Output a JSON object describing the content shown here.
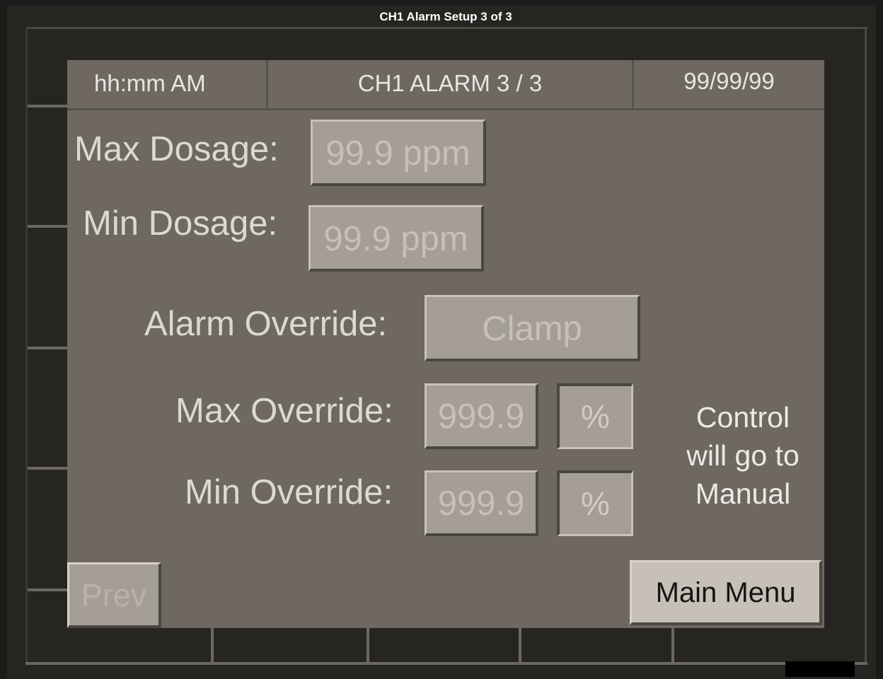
{
  "window": {
    "title": "CH1 Alarm Setup 3 of 3"
  },
  "status_bar": {
    "time": "hh:mm AM",
    "screen_title": "CH1 ALARM 3 / 3",
    "date": "99/99/99"
  },
  "form": {
    "max_dosage": {
      "label": "Max Dosage:",
      "value": "99.9 ppm"
    },
    "min_dosage": {
      "label": "Min Dosage:",
      "value": "99.9 ppm"
    },
    "alarm_override": {
      "label": "Alarm Override:",
      "value": "Clamp"
    },
    "max_override": {
      "label": "Max Override:",
      "value": "999.9",
      "unit": "%"
    },
    "min_override": {
      "label": "Min Override:",
      "value": "999.9",
      "unit": "%"
    },
    "note_lines": [
      "Control",
      "will go to",
      "Manual"
    ]
  },
  "buttons": {
    "prev": "Prev",
    "main_menu": "Main Menu"
  },
  "colors": {
    "screen_bg": "#6e6860",
    "field_bg": "#a59e94",
    "bezel": "#262522"
  }
}
